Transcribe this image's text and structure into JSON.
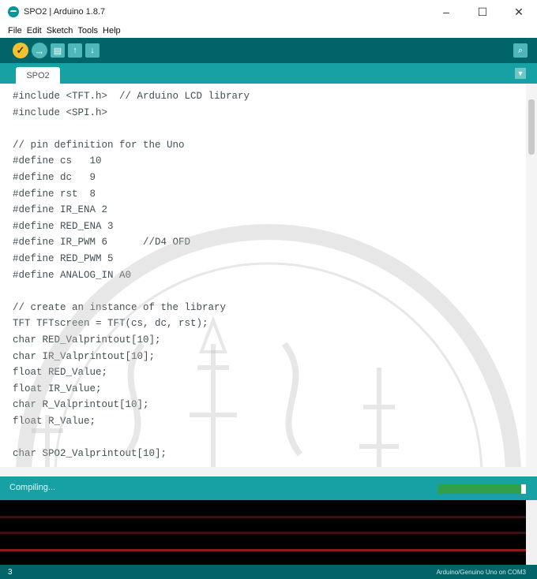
{
  "window": {
    "title": "SPO2 | Arduino 1.8.7",
    "minimize": "–",
    "maximize": "☐",
    "close": "✕"
  },
  "menu": [
    "File",
    "Edit",
    "Sketch",
    "Tools",
    "Help"
  ],
  "toolbar": {
    "verify_glyph": "✓",
    "upload_glyph": "→",
    "new_glyph": "▤",
    "open_glyph": "↑",
    "save_glyph": "↓",
    "serial_glyph": "⌕"
  },
  "tab": {
    "label": "SPO2",
    "menu_glyph": "▼"
  },
  "code": [
    "#include <TFT.h>  // Arduino LCD library",
    "#include <SPI.h>",
    "",
    "// pin definition for the Uno",
    "#define cs   10",
    "#define dc   9",
    "#define rst  8",
    "#define IR_ENA 2",
    "#define RED_ENA 3",
    "#define IR_PWM 6      //D4 OFD",
    "#define RED_PWM 5",
    "#define ANALOG_IN A0",
    "",
    "// create an instance of the library",
    "TFT TFTscreen = TFT(cs, dc, rst);",
    "char RED_Valprintout[10];",
    "char IR_Valprintout[10];",
    "float RED_Value;",
    "float IR_Value;",
    "char R_Valprintout[10];",
    "float R_Value;",
    "",
    "char SPO2_Valprintout[10];"
  ],
  "status": {
    "text": "Compiling...",
    "progress": 0.95
  },
  "footer": {
    "line": "3",
    "board": "Arduino/Genuino Uno on COM3"
  },
  "colors": {
    "toolbar": "#006468",
    "tabbar": "#17a1a5",
    "console": "#000000"
  }
}
